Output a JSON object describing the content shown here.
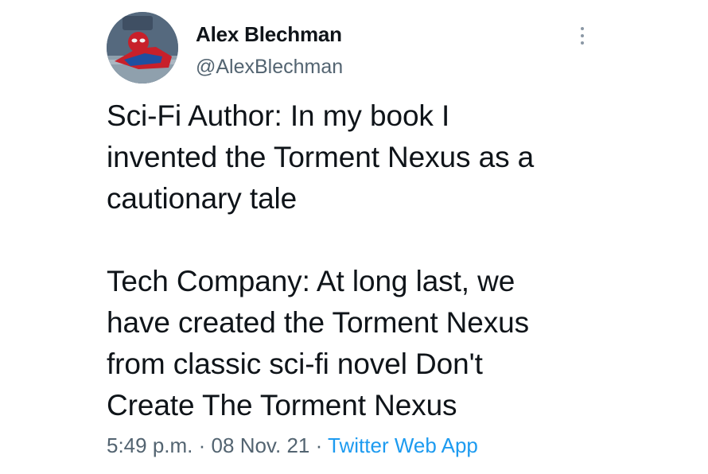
{
  "author": {
    "name": "Alex Blechman",
    "handle": "@AlexBlechman"
  },
  "icons": {
    "avatar": "spider-man-lying-avatar",
    "more": "more-vertical-icon"
  },
  "tweet": {
    "text": "Sci-Fi Author: In my book I\ninvented the Torment Nexus as a\ncautionary tale\n\nTech Company: At long last, we\nhave created the Torment Nexus\nfrom classic sci-fi novel Don't\nCreate The Torment Nexus"
  },
  "meta": {
    "time": "5:49 p.m.",
    "separator": "·",
    "date": "08 Nov. 21",
    "source": "Twitter Web App"
  },
  "colors": {
    "text": "#0f1419",
    "secondary": "#536471",
    "link": "#1d9bf0"
  }
}
